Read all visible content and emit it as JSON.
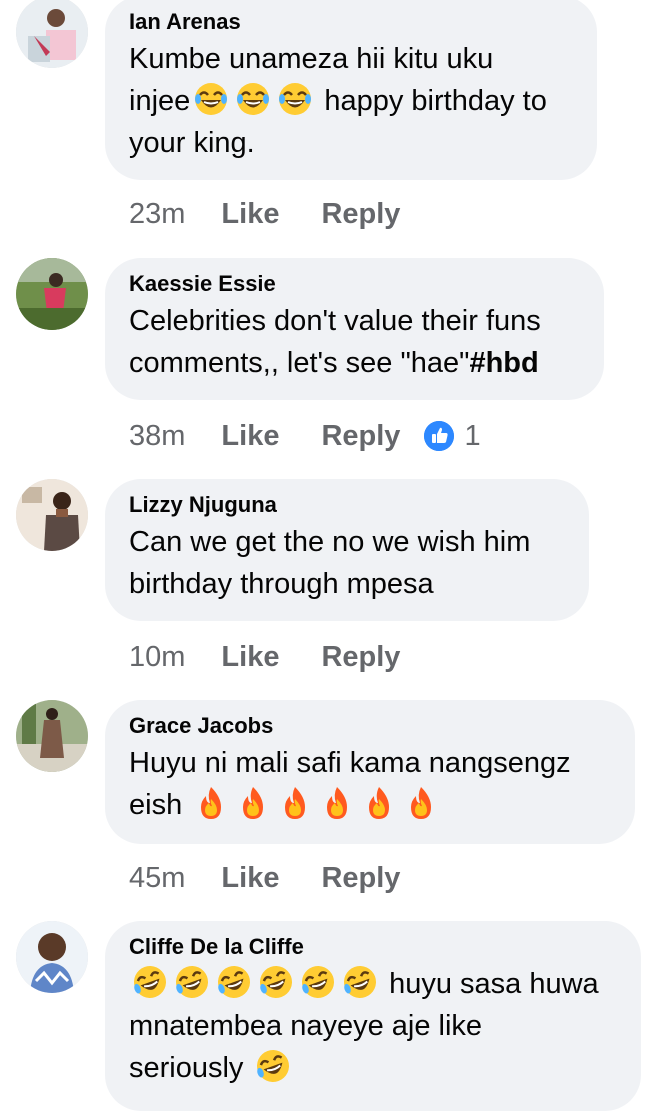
{
  "comments": [
    {
      "author": "Ian Arenas",
      "lines": [
        "Kumbe unameza hii kitu uku",
        "happy birthday to",
        "your king."
      ],
      "line2_prefix": "injee",
      "emojis": [
        "face-with-tears-of-joy",
        "face-with-tears-of-joy",
        "face-with-tears-of-joy"
      ],
      "time": "23m",
      "like_label": "Like",
      "reply_label": "Reply"
    },
    {
      "author": "Kaessie Essie",
      "lines": [
        "Celebrities don't value their funs",
        "comments,, let's see \"hae\""
      ],
      "hashtag": "#hbd",
      "time": "38m",
      "like_label": "Like",
      "reply_label": "Reply",
      "reaction": {
        "icon": "thumbs-up-icon",
        "count": "1",
        "color": "#2d88ff"
      }
    },
    {
      "author": "Lizzy Njuguna",
      "lines": [
        "Can we get the no we wish him",
        "birthday through mpesa"
      ],
      "time": "10m",
      "like_label": "Like",
      "reply_label": "Reply"
    },
    {
      "author": "Grace Jacobs",
      "lines": [
        "Huyu ni mali safi kama nangsengz",
        "eish"
      ],
      "emojis": [
        "fire",
        "fire",
        "fire",
        "fire",
        "fire",
        "fire"
      ],
      "time": "45m",
      "like_label": "Like",
      "reply_label": "Reply"
    },
    {
      "author": "Cliffe De la Cliffe",
      "lines": [
        "huyu sasa huwa",
        "mnatembea nayeye aje like",
        "seriously"
      ],
      "emojis": [
        "rolling-on-the-floor-laughing",
        "rolling-on-the-floor-laughing",
        "rolling-on-the-floor-laughing",
        "rolling-on-the-floor-laughing",
        "rolling-on-the-floor-laughing",
        "rolling-on-the-floor-laughing"
      ],
      "trailing_emoji": "rolling-on-the-floor-laughing"
    }
  ],
  "colors": {
    "bubble": "#f0f2f5",
    "meta": "#65676b",
    "like_badge": "#2d88ff",
    "text": "#050505"
  }
}
